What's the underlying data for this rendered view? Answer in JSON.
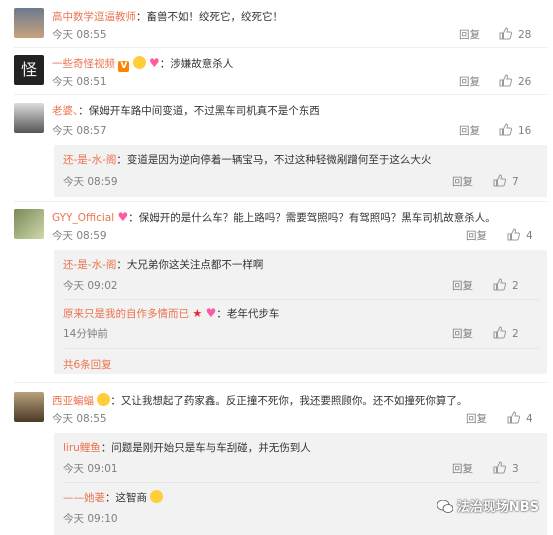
{
  "reply_label": "回复",
  "comments": [
    {
      "name": "高中数学逗逼教师",
      "text": "：畜兽不如！绞死它，绞死它！",
      "time": "今天 08:55",
      "likes": "28"
    },
    {
      "name": "一些奇怪视频",
      "text": "：涉嫌故意杀人",
      "time": "今天 08:51",
      "likes": "26"
    },
    {
      "name": "老婆、",
      "text": "：保姆开车路中间变道，不过黑车司机真不是个东西",
      "time": "今天 08:57",
      "likes": "16"
    },
    {
      "name": "GYY_Official",
      "text": "：保姆开的是什么车？能上路吗？需要驾照吗？有驾照吗？黑车司机故意杀人。",
      "time": "今天 08:59",
      "likes": "4"
    },
    {
      "name": "西亚蝙蝠",
      "text": "：又让我想起了药家鑫。反正撞不死你，我还要照顾你。还不如撞死你算了。",
      "time": "今天 08:55",
      "likes": "4"
    }
  ],
  "replies": [
    {
      "name": "还-是-水-阁",
      "text": "：变道是因为逆向停着一辆宝马，不过这种轻微剐蹭何至于这么大火",
      "time": "今天 08:59",
      "likes": "7"
    },
    {
      "name": "还-是-水-阁",
      "text": "：大兄弟你这关注点都不一样啊",
      "time": "今天 09:02",
      "likes": "2"
    },
    {
      "name": "原来只是我的自作多情而已",
      "text": "：老年代步车",
      "time": "14分钟前",
      "likes": "2"
    },
    {
      "name": "liru鲤鱼",
      "text": "：问题是刚开始只是车与车刮碰，并无伤到人",
      "time": "今天 09:01",
      "likes": "3"
    },
    {
      "name": "——她荖",
      "text": "：这智商",
      "time": "今天 09:10",
      "likes": ""
    }
  ],
  "more_replies": "共6条回复",
  "watermark": "法治现场NBS",
  "colors": {
    "name": "#eb7350",
    "meta": "#808080",
    "subbg": "#f2f2f2"
  },
  "icons": [
    "like-icon",
    "verified-v-icon",
    "heart-icon",
    "star-icon",
    "laugh-emoji-icon",
    "wechat-logo-icon"
  ]
}
